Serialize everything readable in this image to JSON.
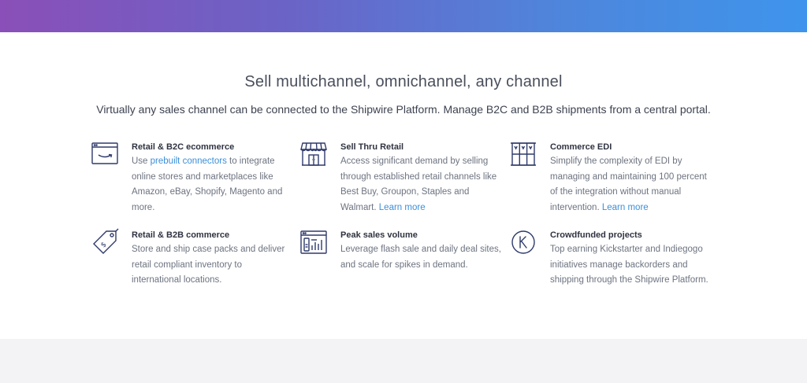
{
  "header": {
    "title": "Sell multichannel, omnichannel, any channel",
    "subtitle": "Virtually any sales channel can be connected to the Shipwire Platform. Manage B2C and B2B shipments from a central portal."
  },
  "features": {
    "retail_b2c": {
      "title": "Retail & B2C ecommerce",
      "pre": "Use ",
      "link": "prebuilt connectors",
      "post": " to integrate online stores and marketplaces like Amazon, eBay, Shopify, Magento and more.",
      "icon": "amazon-browser-icon"
    },
    "sell_thru": {
      "title": "Sell Thru Retail",
      "pre": "Access significant demand by selling through established retail channels like Best Buy, Groupon, Staples and Walmart. ",
      "link": "Learn more",
      "icon": "storefront-icon"
    },
    "edi": {
      "title": "Commerce EDI",
      "pre": "Simplify the complexity of EDI by managing and maintaining 100 percent of the integration without manual intervention. ",
      "link": "Learn more",
      "icon": "window-grid-icon"
    },
    "retail_b2b": {
      "title": "Retail & B2B commerce",
      "desc": "Store and ship case packs and deliver retail compliant inventory to international locations.",
      "icon": "price-tag-icon"
    },
    "peak": {
      "title": "Peak sales volume",
      "desc": "Leverage flash sale and daily deal sites, and scale for spikes in demand.",
      "icon": "sales-dashboard-icon"
    },
    "crowdfunded": {
      "title": "Crowdfunded projects",
      "desc": "Top earning Kickstarter and Indiegogo initiatives manage backorders and shipping through the Shipwire Platform.",
      "icon": "kickstarter-icon"
    }
  },
  "colors": {
    "accent": "#3b8fd9",
    "icon_stroke": "#2f3a6b",
    "gradient_start": "#8a4fb8",
    "gradient_end": "#3e94ec"
  }
}
